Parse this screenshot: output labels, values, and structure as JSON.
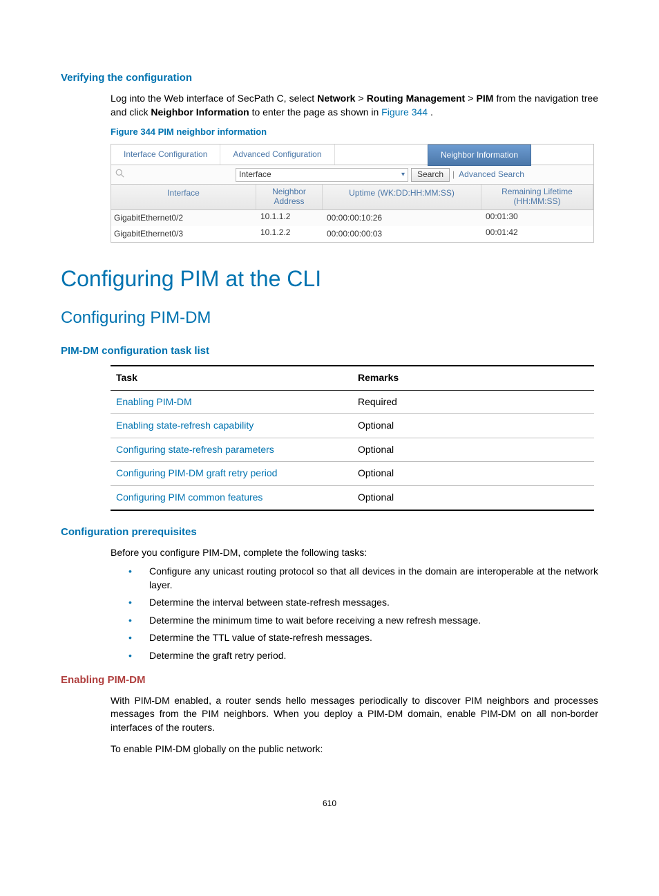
{
  "sections": {
    "verify_heading": "Verifying the configuration",
    "verify_text_1a": "Log into the Web interface of SecPath C, select ",
    "verify_text_1b": " from the navigation tree and click ",
    "verify_text_1c": " to enter the page as shown in ",
    "verify_text_1d": ".",
    "bold_network": "Network",
    "bold_routing": "Routing Management",
    "bold_pim": "PIM",
    "bold_neighbor": "Neighbor Information",
    "sep": " > ",
    "fig_ref": "Figure 344",
    "figure_caption": "Figure 344 PIM neighbor information",
    "h1": "Configuring PIM at the CLI",
    "h2": "Configuring PIM-DM",
    "tasklist_heading": "PIM-DM configuration task list",
    "prereq_heading": "Configuration prerequisites",
    "prereq_intro": "Before you configure PIM-DM, complete the following tasks:",
    "enable_heading": "Enabling PIM-DM",
    "enable_p1": "With PIM-DM enabled, a router sends hello messages periodically to discover PIM neighbors and processes messages from the PIM neighbors. When you deploy a PIM-DM domain, enable PIM-DM on all non-border interfaces of the routers.",
    "enable_p2": "To enable PIM-DM globally on the public network:",
    "pagenum": "610"
  },
  "screenshot": {
    "tab1": "Interface Configuration",
    "tab2": "Advanced Configuration",
    "tab3": "Neighbor Information",
    "search_select": "Interface",
    "search_btn": "Search",
    "adv_search": "Advanced Search",
    "headers": {
      "interface": "Interface",
      "neighbor": "Neighbor Address",
      "uptime": "Uptime (WK:DD:HH:MM:SS)",
      "remaining": "Remaining Lifetime (HH:MM:SS)"
    },
    "rows": [
      {
        "if": "GigabitEthernet0/2",
        "na": "10.1.1.2",
        "up": "00:00:00:10:26",
        "rl": "00:01:30"
      },
      {
        "if": "GigabitEthernet0/3",
        "na": "10.1.2.2",
        "up": "00:00:00:00:03",
        "rl": "00:01:42"
      }
    ]
  },
  "task_table": {
    "th_task": "Task",
    "th_remarks": "Remarks",
    "rows": [
      {
        "task": "Enabling PIM-DM",
        "remarks": "Required"
      },
      {
        "task": "Enabling state-refresh capability",
        "remarks": "Optional"
      },
      {
        "task": "Configuring state-refresh parameters",
        "remarks": "Optional"
      },
      {
        "task": "Configuring PIM-DM graft retry period",
        "remarks": "Optional"
      },
      {
        "task": "Configuring PIM common features",
        "remarks": "Optional"
      }
    ]
  },
  "bullets": [
    "Configure any unicast routing protocol so that all devices in the domain are interoperable at the network layer.",
    "Determine the interval between state-refresh messages.",
    "Determine the minimum time to wait before receiving a new refresh message.",
    "Determine the TTL value of state-refresh messages.",
    "Determine the graft retry period."
  ]
}
